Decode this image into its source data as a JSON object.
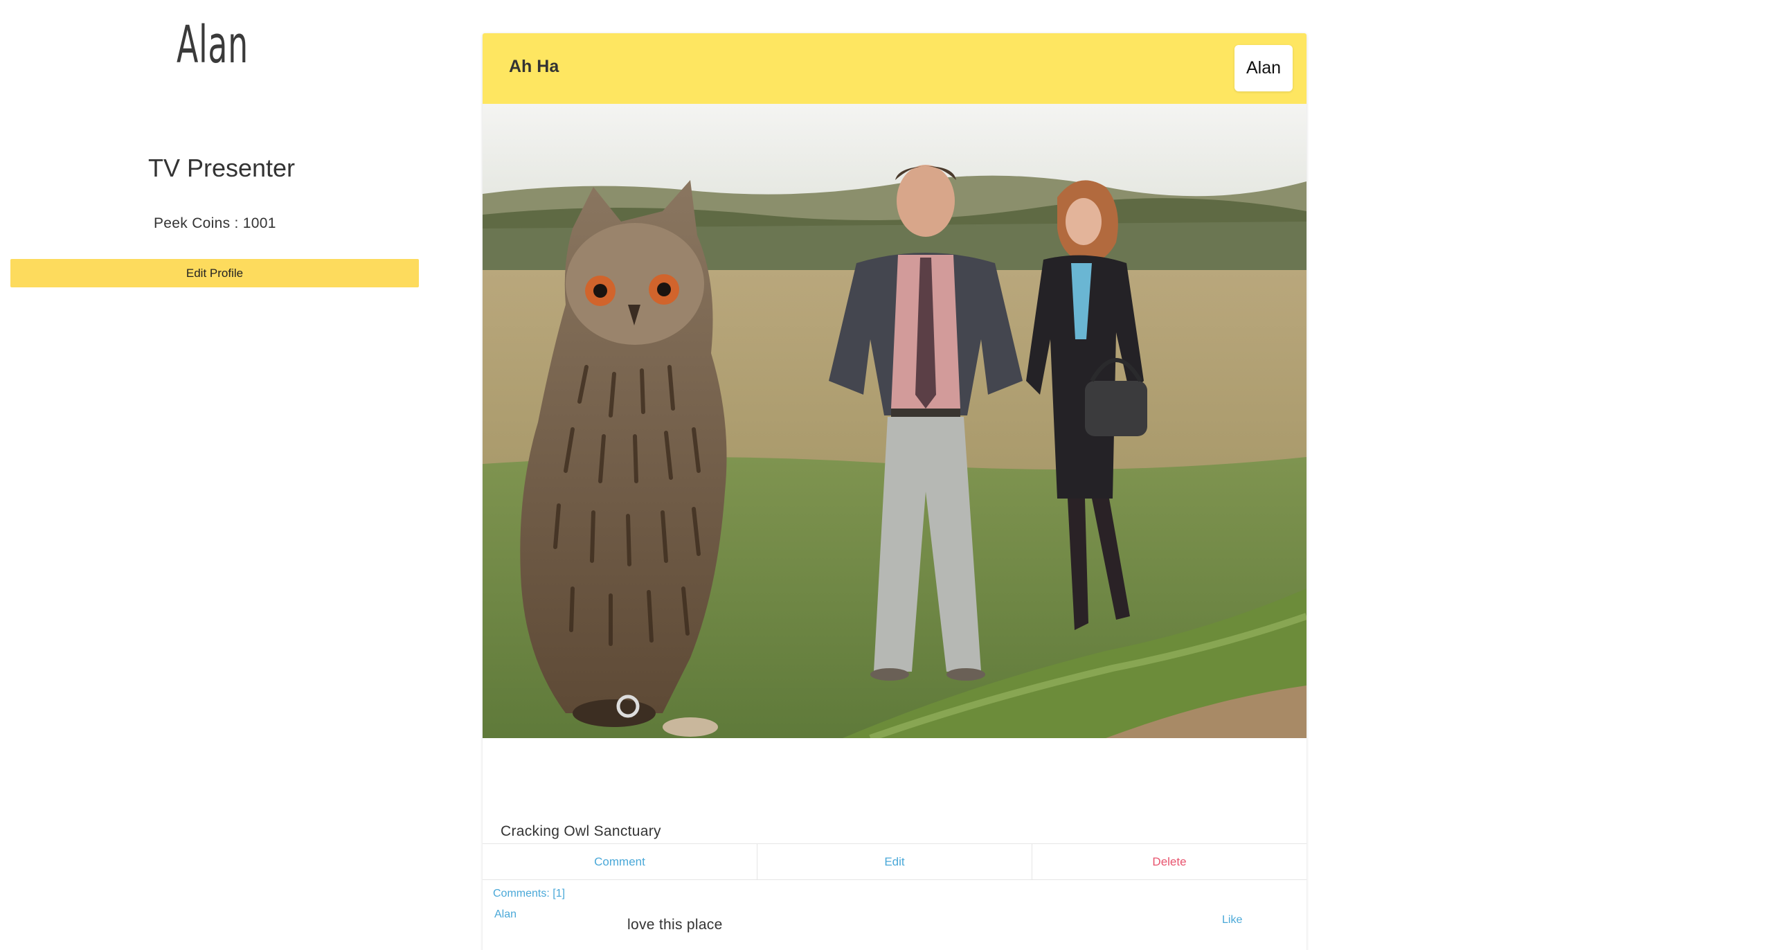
{
  "sidebar": {
    "name": "Alan",
    "title": "TV Presenter",
    "peek_coins_label": "Peek Coins : ",
    "peek_coins_value": "1001",
    "edit_profile_label": "Edit Profile"
  },
  "post": {
    "title": "Ah Ha",
    "author": "Alan",
    "image_alt": "owl and two people standing in a field",
    "caption": "Cracking Owl Sanctuary",
    "actions": {
      "comment": "Comment",
      "edit": "Edit",
      "delete": "Delete"
    },
    "comments_label": "Comments: [1]",
    "comments": [
      {
        "author": "Alan",
        "text": "love this place",
        "like_label": "Like"
      }
    ]
  },
  "colors": {
    "header_yellow": "#fee661",
    "button_yellow": "#fddb5d",
    "link_blue": "#4aa8d8",
    "delete_red": "#e8546e"
  }
}
